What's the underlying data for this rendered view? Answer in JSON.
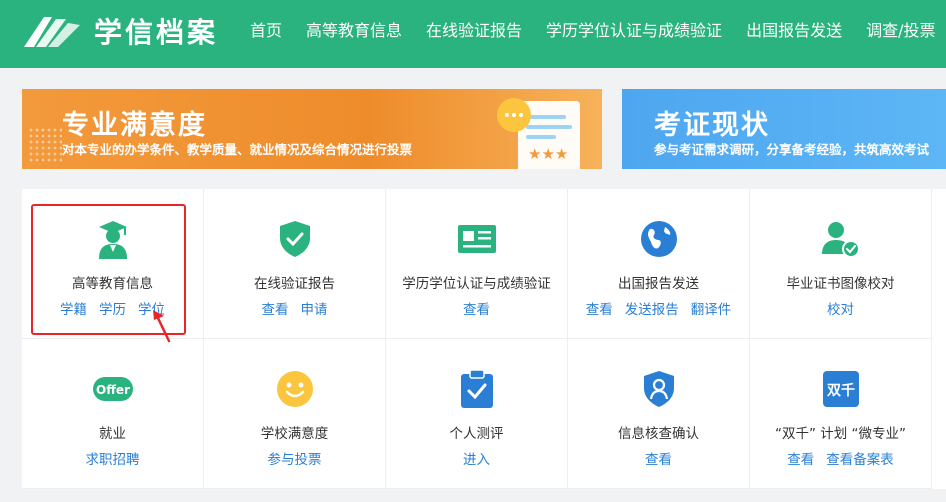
{
  "header": {
    "logo_text": "学信档案",
    "nav": [
      "首页",
      "高等教育信息",
      "在线验证报告",
      "学历学位认证与成绩验证",
      "出国报告发送",
      "调查/投票"
    ]
  },
  "banners": [
    {
      "title": "专业满意度",
      "subtitle": "对本专业的办学条件、教学质量、就业情况及综合情况进行投票"
    },
    {
      "title": "考证现状",
      "subtitle": "参与考证需求调研，分享备考经验，共筑高效考试"
    }
  ],
  "services": [
    {
      "title": "高等教育信息",
      "icon": "graduate-icon",
      "links": [
        "学籍",
        "学历",
        "学位"
      ]
    },
    {
      "title": "在线验证报告",
      "icon": "shield-check-icon",
      "links": [
        "查看",
        "申请"
      ]
    },
    {
      "title": "学历学位认证与成绩验证",
      "icon": "certificate-card-icon",
      "links": [
        "查看"
      ]
    },
    {
      "title": "出国报告发送",
      "icon": "globe-icon",
      "links": [
        "查看",
        "发送报告",
        "翻译件"
      ]
    },
    {
      "title": "毕业证书图像校对",
      "icon": "user-check-icon",
      "links": [
        "校对"
      ]
    },
    {
      "title": "就业",
      "icon": "offer-icon",
      "icon_text": "Offer",
      "links": [
        "求职招聘"
      ]
    },
    {
      "title": "学校满意度",
      "icon": "smiley-icon",
      "links": [
        "参与投票"
      ]
    },
    {
      "title": "个人测评",
      "icon": "clipboard-check-icon",
      "links": [
        "进入"
      ]
    },
    {
      "title": "信息核查确认",
      "icon": "user-shield-icon",
      "links": [
        "查看"
      ]
    },
    {
      "title": "“双千” 计划 “微专业”",
      "icon": "shuangqian-icon",
      "icon_text": "双千",
      "links": [
        "查看",
        "查看备案表"
      ]
    }
  ],
  "colors": {
    "header_bg": "#2bb37f",
    "icon_green": "#2bb37f",
    "icon_blue": "#2a7fd4",
    "link": "#2a7fd4",
    "highlight_border": "#e8262a"
  }
}
